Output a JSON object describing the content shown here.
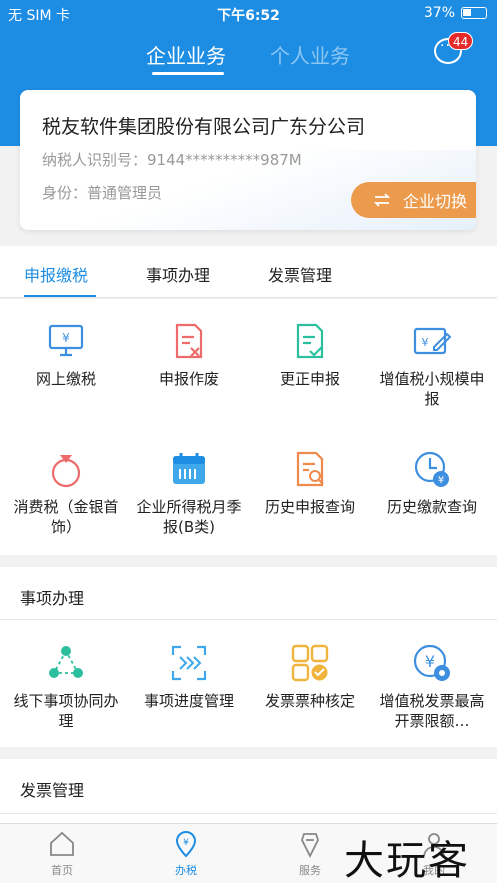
{
  "status": {
    "carrier": "无 SIM 卡",
    "time": "下午6:52",
    "battery": "37%"
  },
  "header": {
    "tab_business": "企业业务",
    "tab_personal": "个人业务",
    "badge": "44"
  },
  "company": {
    "name": "税友软件集团股份有限公司广东分公司",
    "tax_id": "纳税人识别号：9144**********987M",
    "role": "身份：普通管理员",
    "switch_label": "企业切换"
  },
  "section_tabs": [
    "申报缴税",
    "事项办理",
    "发票管理"
  ],
  "declare_items": [
    {
      "label": "网上缴税",
      "icon": "monitor-yuan-icon"
    },
    {
      "label": "申报作废",
      "icon": "doc-cancel-icon"
    },
    {
      "label": "更正申报",
      "icon": "doc-check-icon"
    },
    {
      "label": "增值税小规模申报",
      "icon": "ticket-edit-icon"
    },
    {
      "label": "消费税（金银首饰）",
      "icon": "ring-icon"
    },
    {
      "label": "企业所得税月季报(B类)",
      "icon": "calendar-icon"
    },
    {
      "label": "历史申报查询",
      "icon": "doc-search-icon"
    },
    {
      "label": "历史缴款查询",
      "icon": "clock-yuan-icon"
    }
  ],
  "matter": {
    "title": "事项办理",
    "items": [
      {
        "label": "线下事项协同办理",
        "icon": "collaborate-icon"
      },
      {
        "label": "事项进度管理",
        "icon": "progress-scan-icon"
      },
      {
        "label": "发票票种核定",
        "icon": "grid-check-icon"
      },
      {
        "label": "增值税发票最高开票限额…",
        "icon": "yuan-gear-icon"
      }
    ]
  },
  "invoice": {
    "title": "发票管理"
  },
  "tabbar": [
    {
      "label": "首页",
      "icon": "home-icon"
    },
    {
      "label": "办税",
      "icon": "location-yuan-icon"
    },
    {
      "label": "服务",
      "icon": "service-icon"
    },
    {
      "label": "我的",
      "icon": "user-icon"
    }
  ],
  "watermark": "大玩客",
  "colors": {
    "primary": "#1d8de3",
    "accent": "#ec9b4c",
    "badge": "#e52a2a"
  }
}
